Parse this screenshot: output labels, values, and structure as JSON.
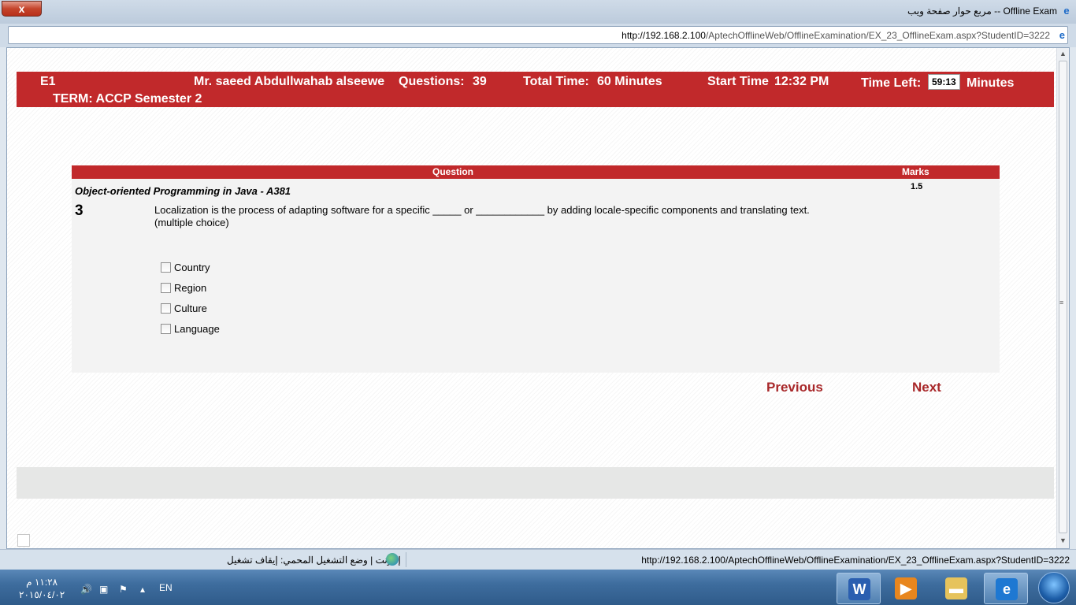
{
  "window": {
    "title": "Offline Exam -- مربع حوار صفحة ويب",
    "close_label": "x"
  },
  "address": {
    "url_host": "http://192.168.2.100",
    "url_path": "/AptechOfflineWeb/OfflineExamination/EX_23_OfflineExam.aspx?StudentID=3222"
  },
  "header": {
    "code": "E1",
    "student": "Mr. saeed Abdullwahab alseewe",
    "questions_label": "Questions:",
    "questions_value": "39",
    "total_time_label": "Total Time:",
    "total_time_value": "60 Minutes",
    "start_time_label": "Start Time",
    "start_time_value": "12:32 PM",
    "time_left_label": "Time Left:",
    "time_left_value": "59:13",
    "time_left_unit": "Minutes",
    "term": "TERM: ACCP Semester 2"
  },
  "question": {
    "col_question": "Question",
    "col_marks": "Marks",
    "subject": "Object-oriented Programming in Java - A381",
    "marks": "1.5",
    "number": "3",
    "text": "Localization is the process of adapting software for a specific _____ or ____________ by adding locale-specific components and translating text.",
    "type": "(multiple choice)",
    "options": [
      "Country",
      "Region",
      "Culture",
      "Language"
    ]
  },
  "nav": {
    "previous": "Previous",
    "next": "Next"
  },
  "status": {
    "zone": "إنترنت | وضع التشغيل المحمي: إيقاف تشغيل",
    "url": "http://192.168.2.100/AptechOfflineWeb/OfflineExamination/EX_23_OfflineExam.aspx?StudentID=3222"
  },
  "taskbar": {
    "time": "١١:٢٨ م",
    "date": "٢٠١٥/٠٤/٠٢",
    "language": "EN",
    "apps": [
      "word-icon",
      "media-player-icon",
      "folder-icon",
      "internet-explorer-icon"
    ]
  },
  "colors": {
    "brand_red": "#c1292b",
    "link_red": "#a8282a"
  }
}
